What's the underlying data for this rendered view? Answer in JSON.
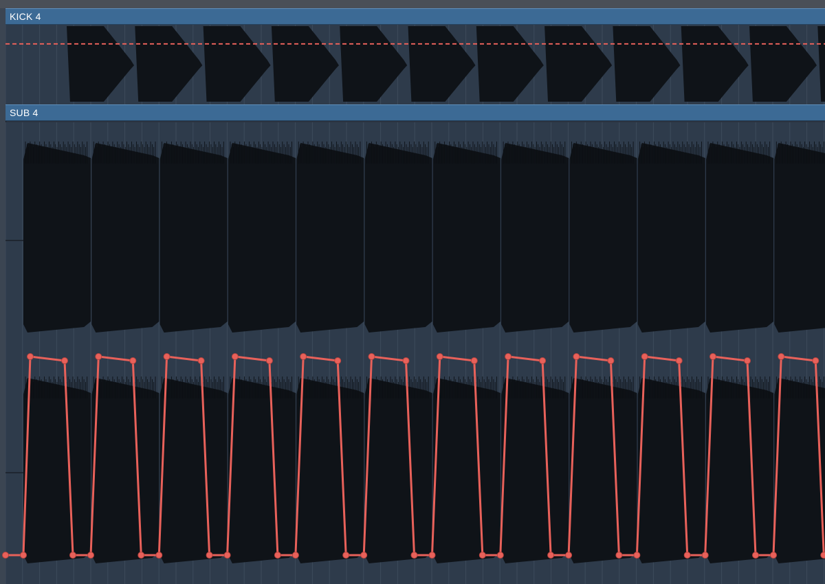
{
  "regions": {
    "kick": {
      "name": "KICK 4"
    },
    "sub": {
      "name": "SUB 4"
    }
  },
  "kick_volume_level": 0.76,
  "pattern_count": 12,
  "colors": {
    "region_header": "#3c6a95",
    "region_body": "#2e3b4b",
    "waveform": "#0f1318",
    "automation": "#e8615a",
    "grid_line": "#3d4b5b"
  },
  "icons": {
    "automation_point": "circle-node"
  }
}
